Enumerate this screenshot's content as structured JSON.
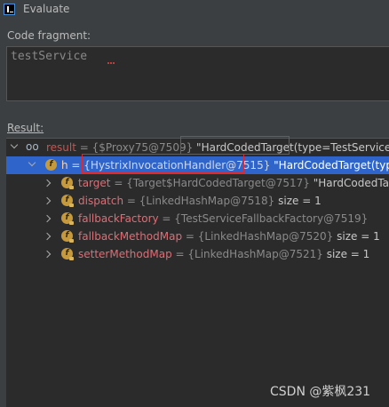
{
  "window": {
    "title": "Evaluate"
  },
  "code_fragment": {
    "label": "Code fragment:",
    "value": "testService"
  },
  "result": {
    "label": "Result:"
  },
  "tree": {
    "root": {
      "name": "result",
      "eq": " = ",
      "type": "{$Proxy75@7509}",
      "value": " \"HardCodedTarget(type=TestService, na"
    },
    "h": {
      "name": "h",
      "eq": " = ",
      "type": "{HystrixInvocationHandler@7515}",
      "value": " \"HardCodedTarget(type="
    },
    "children": [
      {
        "name": "target",
        "eq": " = ",
        "type": "{Target$HardCodedTarget@7517}",
        "value": " \"HardCodedTarg"
      },
      {
        "name": "dispatch",
        "eq": " = ",
        "type": "{LinkedHashMap@7518}",
        "value": "  size = 1"
      },
      {
        "name": "fallbackFactory",
        "eq": " = ",
        "type": "{TestServiceFallbackFactory@7519}",
        "value": ""
      },
      {
        "name": "fallbackMethodMap",
        "eq": " = ",
        "type": "{LinkedHashMap@7520}",
        "value": "  size = 1"
      },
      {
        "name": "setterMethodMap",
        "eq": " = ",
        "type": "{LinkedHashMap@7521}",
        "value": "  size = 1"
      }
    ]
  },
  "watermark": "CSDN @紫枫231",
  "colors": {
    "selection": "#2f65ca",
    "field_name": "#cc7832",
    "highlight_box": "#e0282e",
    "badge": "#c69a3c"
  }
}
